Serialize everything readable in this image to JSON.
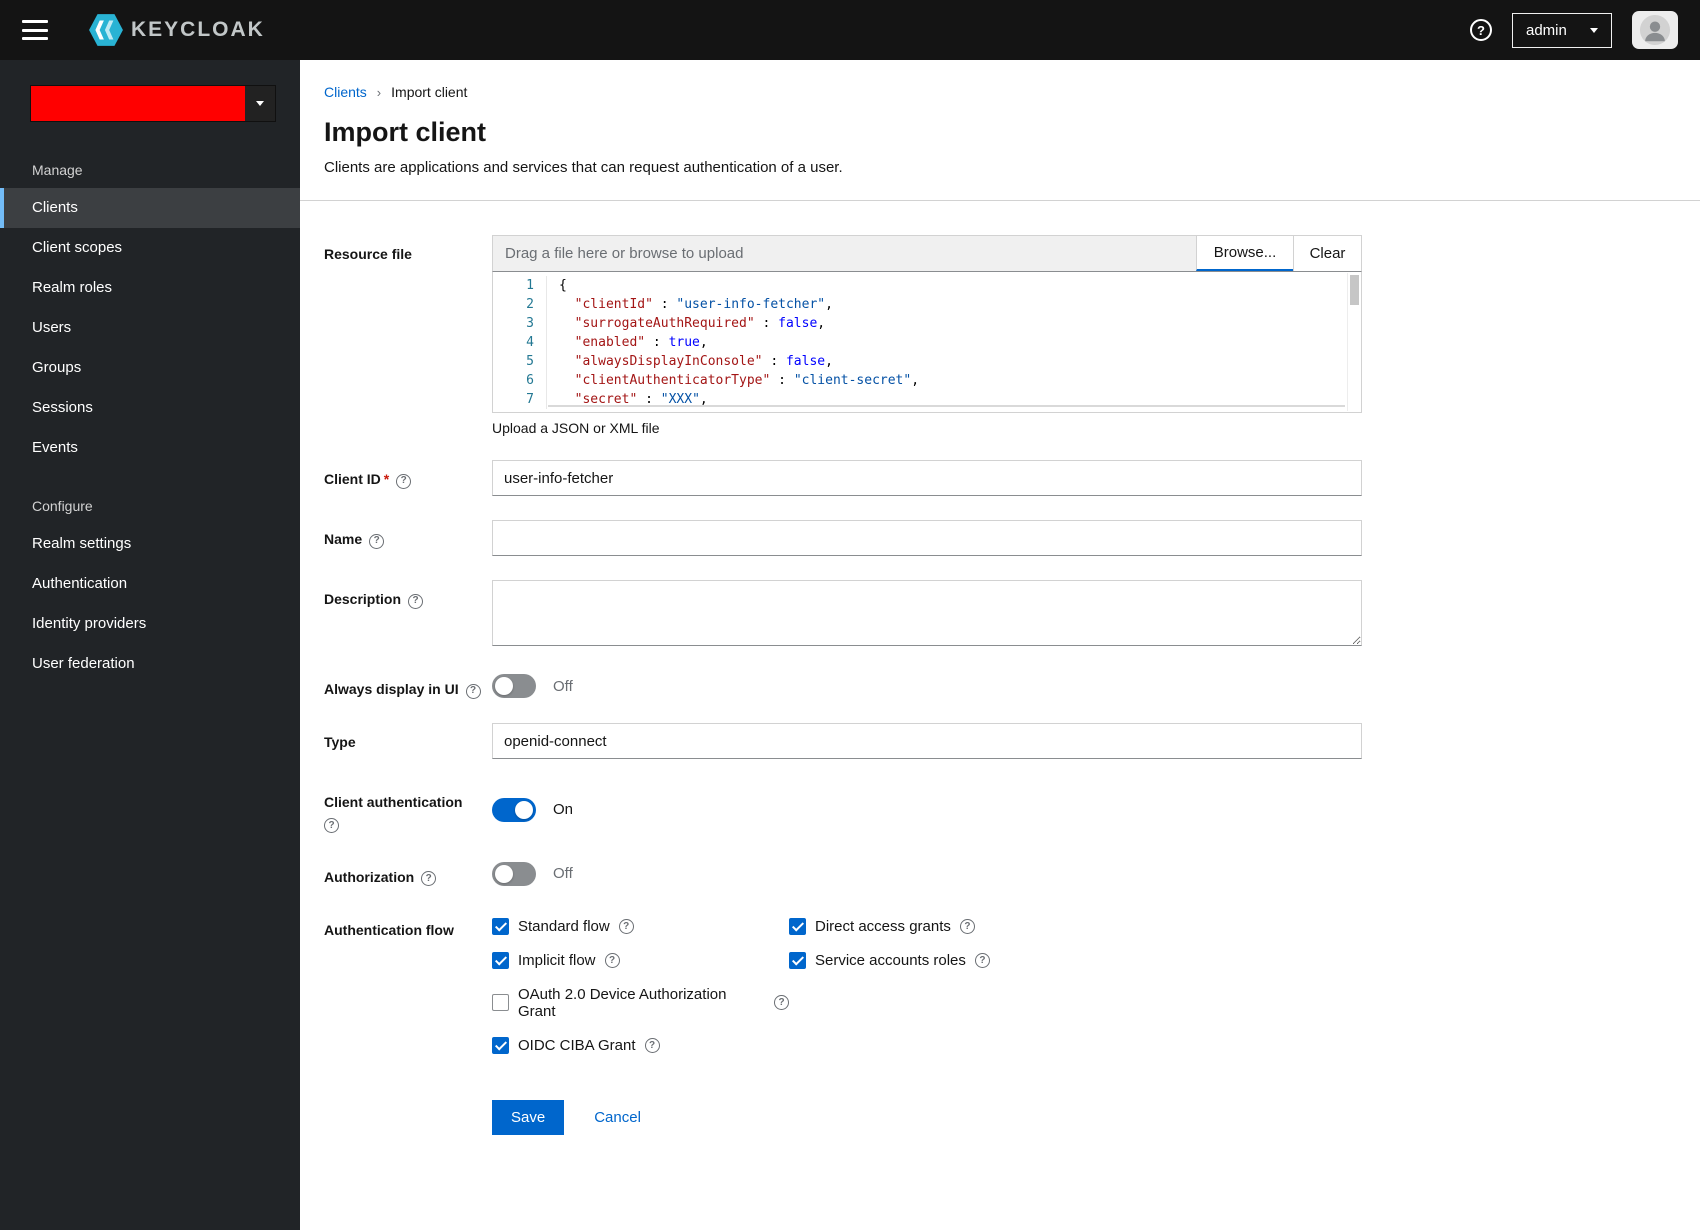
{
  "colors": {
    "accent": "#0066cc",
    "brand_icon": "#29b3d4",
    "realm_redaction": "#ff0000"
  },
  "icons": {
    "help": "?"
  },
  "topbar": {
    "brand": "KEYCLOAK",
    "user_menu": "admin"
  },
  "sidebar": {
    "realm_selector": {
      "color": "#ff0000"
    },
    "groups": [
      {
        "title": "Manage",
        "items": [
          {
            "label": "Clients",
            "current": true
          },
          {
            "label": "Client scopes"
          },
          {
            "label": "Realm roles"
          },
          {
            "label": "Users"
          },
          {
            "label": "Groups"
          },
          {
            "label": "Sessions"
          },
          {
            "label": "Events"
          }
        ]
      },
      {
        "title": "Configure",
        "items": [
          {
            "label": "Realm settings"
          },
          {
            "label": "Authentication"
          },
          {
            "label": "Identity providers"
          },
          {
            "label": "User federation"
          }
        ]
      }
    ]
  },
  "breadcrumb": {
    "parent": "Clients",
    "separator": "›",
    "current": "Import client"
  },
  "page": {
    "title": "Import client",
    "subtitle": "Clients are applications and services that can request authentication of a user."
  },
  "upload": {
    "label": "Resource file",
    "placeholder": "Drag a file here or browse to upload",
    "browse": "Browse...",
    "clear": "Clear",
    "helper": "Upload a JSON or XML file"
  },
  "code": {
    "lines": [
      {
        "n": "1",
        "k": "{"
      },
      {
        "n": "2",
        "k": "  \"clientId\"",
        "sep": " : ",
        "v": "\"user-info-fetcher\"",
        "end": ","
      },
      {
        "n": "3",
        "k": "  \"surrogateAuthRequired\"",
        "sep": " : ",
        "v": "false",
        "end": ","
      },
      {
        "n": "4",
        "k": "  \"enabled\"",
        "sep": " : ",
        "v": "true",
        "end": ","
      },
      {
        "n": "5",
        "k": "  \"alwaysDisplayInConsole\"",
        "sep": " : ",
        "v": "false",
        "end": ","
      },
      {
        "n": "6",
        "k": "  \"clientAuthenticatorType\"",
        "sep": " : ",
        "v": "\"client-secret\"",
        "end": ","
      },
      {
        "n": "7",
        "k": "  \"secret\"",
        "sep": " : ",
        "v": "\"XXX\"",
        "end": ","
      }
    ]
  },
  "fields": {
    "client_id": {
      "label": "Client ID",
      "required": "*",
      "value": "user-info-fetcher"
    },
    "name": {
      "label": "Name",
      "value": ""
    },
    "description": {
      "label": "Description",
      "value": ""
    },
    "always_display": {
      "label": "Always display in UI",
      "on": false,
      "state": "Off"
    },
    "type": {
      "label": "Type",
      "value": "openid-connect"
    },
    "client_auth": {
      "label": "Client authentication",
      "on": true,
      "state": "On"
    },
    "authorization": {
      "label": "Authorization",
      "on": false,
      "state": "Off"
    },
    "auth_flow": {
      "label": "Authentication flow",
      "options": [
        {
          "label": "Standard flow",
          "checked": true
        },
        {
          "label": "Direct access grants",
          "checked": true
        },
        {
          "label": "Implicit flow",
          "checked": true
        },
        {
          "label": "Service accounts roles",
          "checked": true
        },
        {
          "label": "OAuth 2.0 Device Authorization Grant",
          "checked": false
        },
        {
          "label": "OIDC CIBA Grant",
          "checked": true
        }
      ]
    }
  },
  "actions": {
    "save": "Save",
    "cancel": "Cancel"
  }
}
